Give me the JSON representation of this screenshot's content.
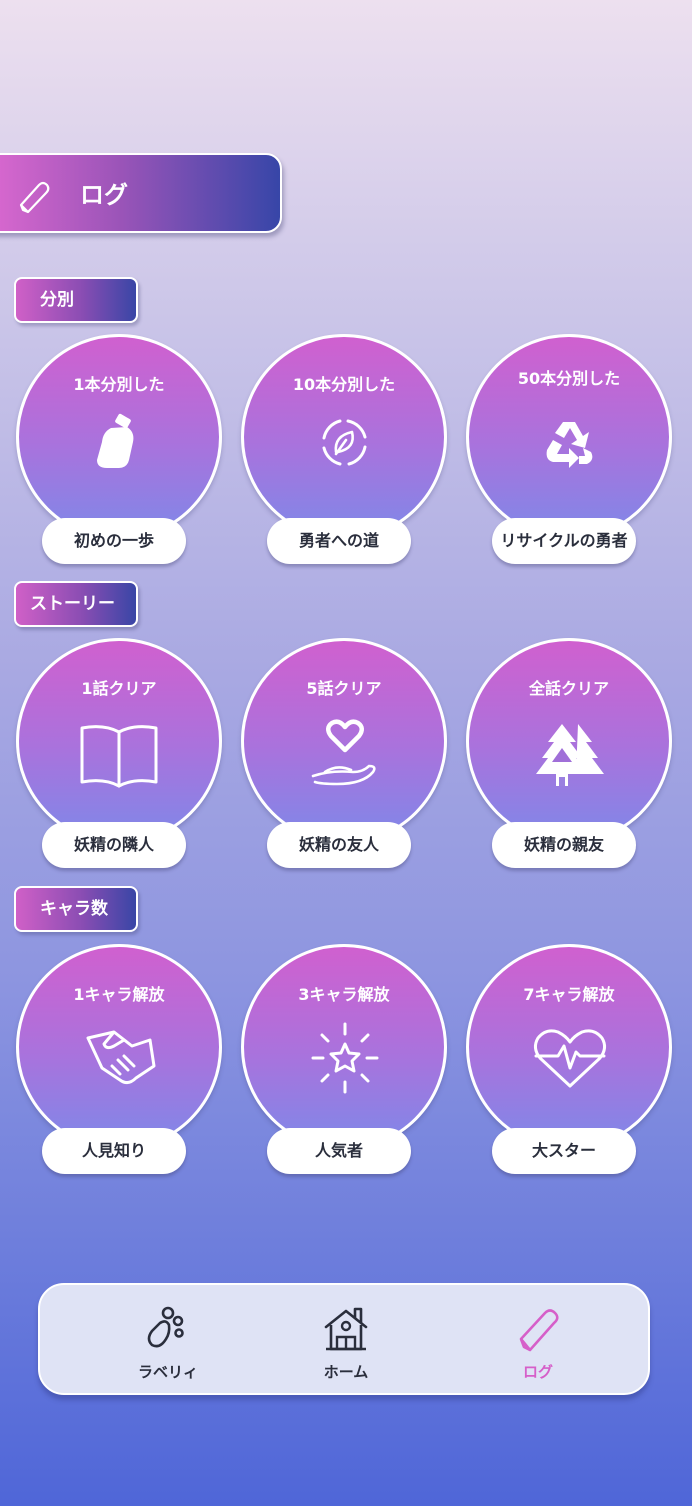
{
  "header": {
    "title": "ログ",
    "icon": "pencil-icon"
  },
  "sections": [
    {
      "label": "分別",
      "badges": [
        {
          "title": "1本分別した",
          "name": "初めの一歩",
          "icon": "bottle-icon"
        },
        {
          "title": "10本分別した",
          "name": "勇者への道",
          "icon": "leaf-cycle-icon"
        },
        {
          "title": "50本分別した",
          "name": "リサイクルの勇者",
          "icon": "recycle-icon"
        }
      ]
    },
    {
      "label": "ストーリー",
      "badges": [
        {
          "title": "1話クリア",
          "name": "妖精の隣人",
          "icon": "book-icon"
        },
        {
          "title": "5話クリア",
          "name": "妖精の友人",
          "icon": "heart-hand-icon"
        },
        {
          "title": "全話クリア",
          "name": "妖精の親友",
          "icon": "trees-icon"
        }
      ]
    },
    {
      "label": "キャラ数",
      "badges": [
        {
          "title": "1キャラ解放",
          "name": "人見知り",
          "icon": "handshake-icon"
        },
        {
          "title": "3キャラ解放",
          "name": "人気者",
          "icon": "star-sparkle-icon"
        },
        {
          "title": "7キャラ解放",
          "name": "大スター",
          "icon": "heartbeat-icon"
        }
      ]
    }
  ],
  "nav": [
    {
      "label": "ラベリィ",
      "icon": "paw-icon",
      "active": false
    },
    {
      "label": "ホーム",
      "icon": "home-icon",
      "active": false
    },
    {
      "label": "ログ",
      "icon": "pencil-icon",
      "active": true
    }
  ],
  "colors": {
    "accent": "#d65fc9",
    "nav_text": "#2a2e3c",
    "label_dark": "#3946a6"
  }
}
